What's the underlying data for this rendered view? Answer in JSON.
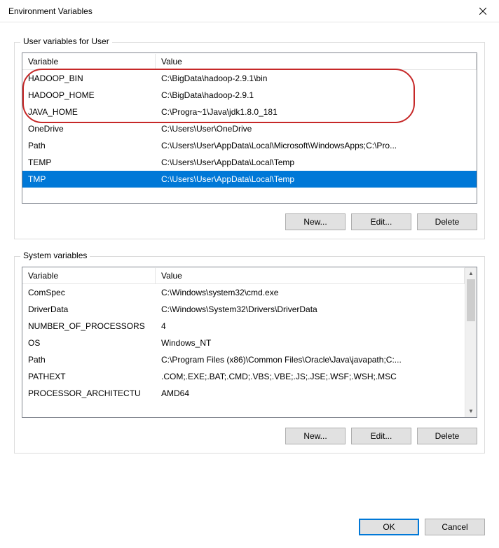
{
  "window": {
    "title": "Environment Variables"
  },
  "user": {
    "group_label": "User variables for User",
    "col_var": "Variable",
    "col_val": "Value",
    "rows": [
      {
        "name": "HADOOP_BIN",
        "value": "C:\\BigData\\hadoop-2.9.1\\bin"
      },
      {
        "name": "HADOOP_HOME",
        "value": "C:\\BigData\\hadoop-2.9.1"
      },
      {
        "name": "JAVA_HOME",
        "value": "C:\\Progra~1\\Java\\jdk1.8.0_181"
      },
      {
        "name": "OneDrive",
        "value": "C:\\Users\\User\\OneDrive"
      },
      {
        "name": "Path",
        "value": "C:\\Users\\User\\AppData\\Local\\Microsoft\\WindowsApps;C:\\Pro..."
      },
      {
        "name": "TEMP",
        "value": "C:\\Users\\User\\AppData\\Local\\Temp"
      },
      {
        "name": "TMP",
        "value": "C:\\Users\\User\\AppData\\Local\\Temp"
      }
    ],
    "selected_index": 6,
    "new_label": "New...",
    "edit_label": "Edit...",
    "delete_label": "Delete"
  },
  "system": {
    "group_label": "System variables",
    "col_var": "Variable",
    "col_val": "Value",
    "rows": [
      {
        "name": "ComSpec",
        "value": "C:\\Windows\\system32\\cmd.exe"
      },
      {
        "name": "DriverData",
        "value": "C:\\Windows\\System32\\Drivers\\DriverData"
      },
      {
        "name": "NUMBER_OF_PROCESSORS",
        "value": "4"
      },
      {
        "name": "OS",
        "value": "Windows_NT"
      },
      {
        "name": "Path",
        "value": "C:\\Program Files (x86)\\Common Files\\Oracle\\Java\\javapath;C:..."
      },
      {
        "name": "PATHEXT",
        "value": ".COM;.EXE;.BAT;.CMD;.VBS;.VBE;.JS;.JSE;.WSF;.WSH;.MSC"
      },
      {
        "name": "PROCESSOR_ARCHITECTU",
        "value": "AMD64"
      }
    ],
    "new_label": "New...",
    "edit_label": "Edit...",
    "delete_label": "Delete"
  },
  "dialog": {
    "ok_label": "OK",
    "cancel_label": "Cancel"
  }
}
